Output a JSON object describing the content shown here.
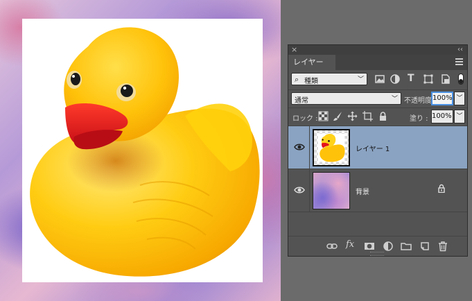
{
  "panel": {
    "close_glyph": "×",
    "collapse_glyph": "‹‹",
    "tab_label": "レイヤー",
    "menu_icon": "panel-menu-icon"
  },
  "filter": {
    "kind_label": "種類",
    "icons": [
      "pixel-layer-filter-icon",
      "adjustment-layer-filter-icon",
      "type-layer-filter-icon",
      "shape-layer-filter-icon",
      "smart-object-filter-icon"
    ],
    "type_glyph": "T"
  },
  "blend": {
    "mode": "通常",
    "opacity_label": "不透明度 :",
    "opacity_value": "100%"
  },
  "lock": {
    "label": "ロック :",
    "fill_label": "塗り :",
    "fill_value": "100%"
  },
  "layers": [
    {
      "name": "レイヤー 1",
      "visible": true,
      "selected": true,
      "locked": false
    },
    {
      "name": "背景",
      "visible": true,
      "selected": false,
      "locked": true
    }
  ],
  "bottom_bar": {
    "icons": [
      "link-layers-icon",
      "fx-icon",
      "layer-mask-icon",
      "adjustment-layer-icon",
      "new-group-icon",
      "new-layer-icon",
      "trash-icon"
    ],
    "fx_label": "fx"
  },
  "colors": {
    "selected_layer": "#8aa3c2",
    "panel_bg": "#535353",
    "focus_ring": "#4a90e2",
    "duck_yellow": "#ffcb05",
    "beak_red": "#e3141d"
  }
}
